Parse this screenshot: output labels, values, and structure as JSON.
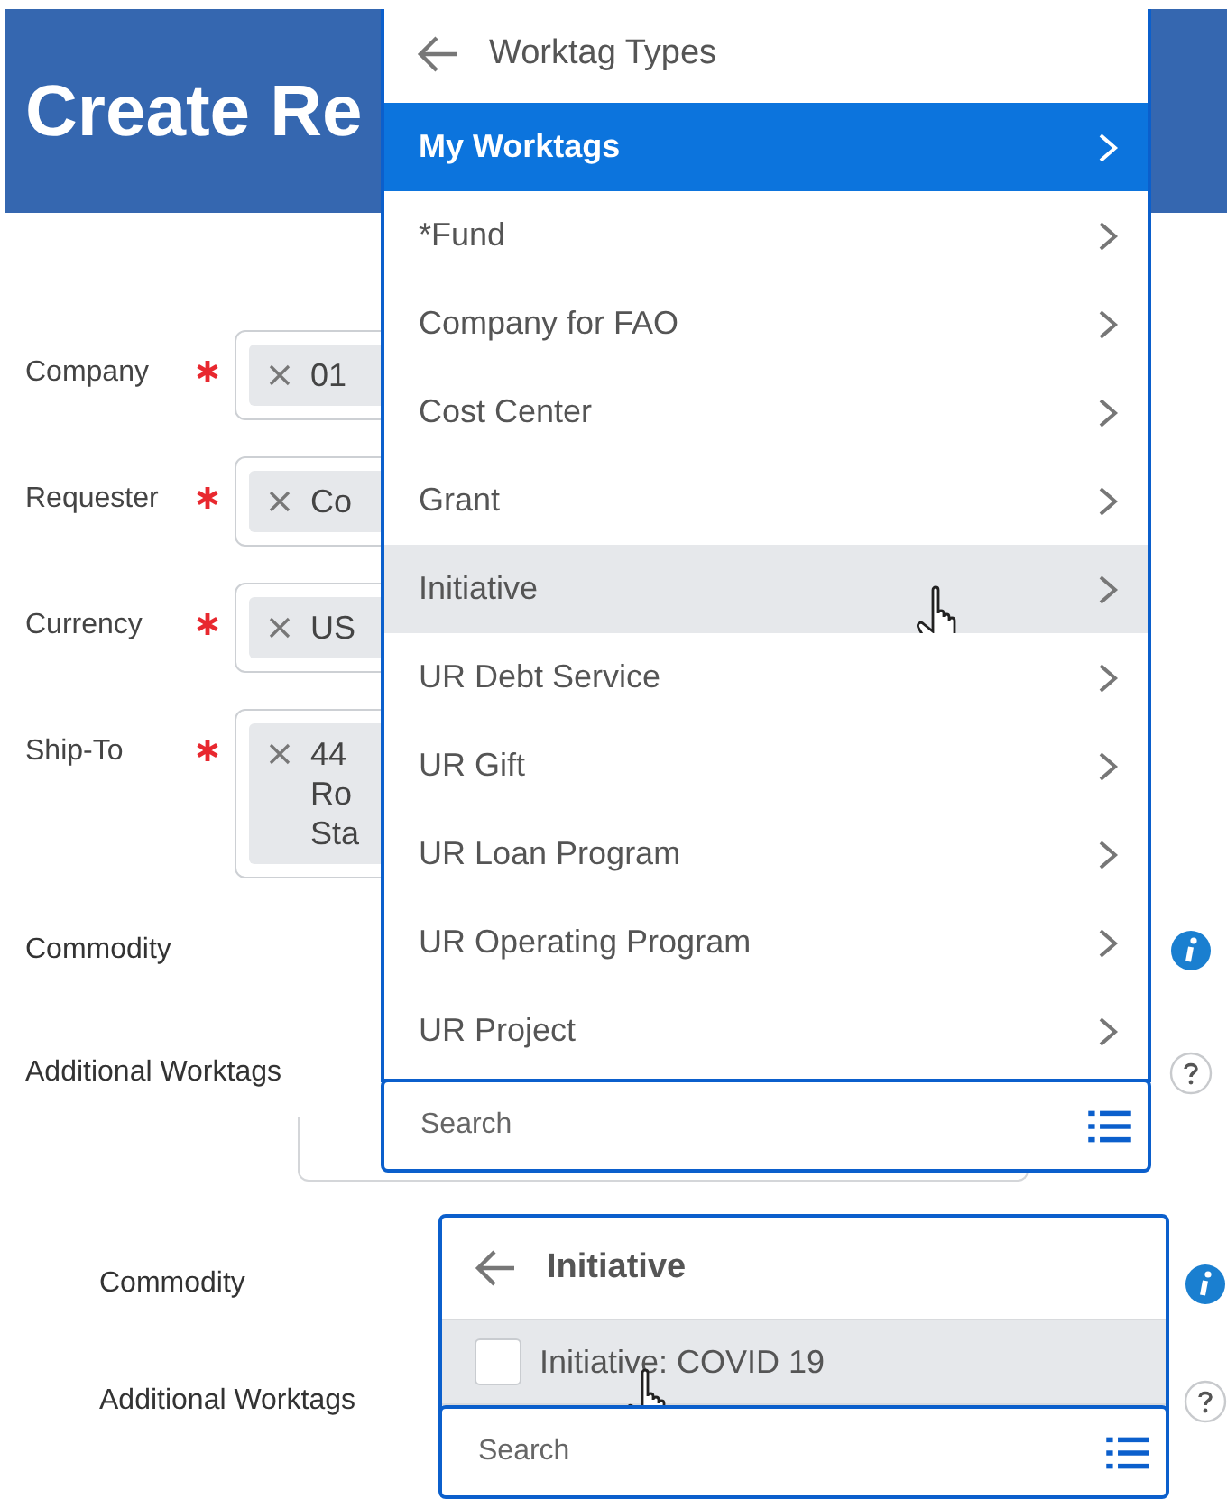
{
  "header": {
    "title": "Create Re"
  },
  "fields": [
    {
      "label": "Company",
      "required": true,
      "value_lines": [
        "01"
      ]
    },
    {
      "label": "Requester",
      "required": true,
      "value_lines": [
        "Co"
      ]
    },
    {
      "label": "Currency",
      "required": true,
      "value_lines": [
        "US"
      ]
    },
    {
      "label": "Ship-To",
      "required": true,
      "value_lines": [
        "44",
        "Ro",
        "Sta"
      ]
    }
  ],
  "lower_fields": [
    {
      "label": "Commodity",
      "kind": "info"
    },
    {
      "label": "Additional Worktags",
      "kind": "help"
    }
  ],
  "worktag_menu": {
    "title": "Worktag Types",
    "items": [
      {
        "label": "My Worktags",
        "selected": true,
        "hovered": false
      },
      {
        "label": "*Fund",
        "selected": false,
        "hovered": false
      },
      {
        "label": "Company for FAO",
        "selected": false,
        "hovered": false
      },
      {
        "label": "Cost Center",
        "selected": false,
        "hovered": false
      },
      {
        "label": "Grant",
        "selected": false,
        "hovered": false
      },
      {
        "label": "Initiative",
        "selected": false,
        "hovered": true
      },
      {
        "label": "UR Debt Service",
        "selected": false,
        "hovered": false
      },
      {
        "label": "UR Gift",
        "selected": false,
        "hovered": false
      },
      {
        "label": "UR Loan Program",
        "selected": false,
        "hovered": false
      },
      {
        "label": "UR Operating Program",
        "selected": false,
        "hovered": false
      },
      {
        "label": "UR Project",
        "selected": false,
        "hovered": false
      }
    ],
    "search": {
      "placeholder": "Search"
    }
  },
  "inset": {
    "fields": [
      {
        "label": "Commodity",
        "kind": "info"
      },
      {
        "label": "Additional Worktags",
        "kind": "help"
      }
    ],
    "menu": {
      "title": "Initiative",
      "options": [
        {
          "label": "Initiative: COVID 19",
          "checked": false,
          "hovered": true
        }
      ],
      "search": {
        "placeholder": "Search"
      }
    }
  }
}
